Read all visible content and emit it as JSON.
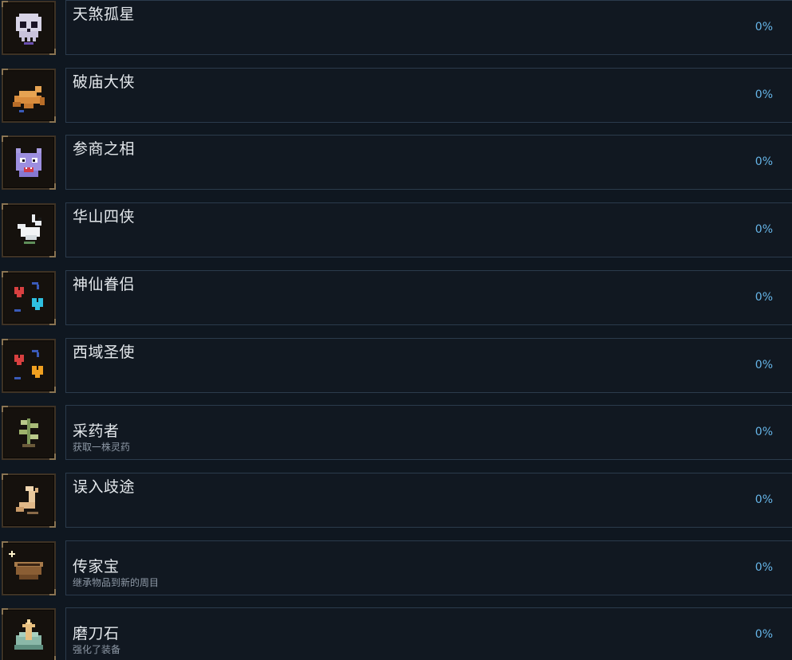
{
  "achievements": [
    {
      "title": "天煞孤星",
      "description": "",
      "percent": "0%",
      "icon": "skull-icon"
    },
    {
      "title": "破庙大侠",
      "description": "",
      "percent": "0%",
      "icon": "fallen-fox-icon"
    },
    {
      "title": "参商之相",
      "description": "",
      "percent": "0%",
      "icon": "purple-demon-face-icon"
    },
    {
      "title": "华山四侠",
      "description": "",
      "percent": "0%",
      "icon": "white-crane-icon"
    },
    {
      "title": "神仙眷侣",
      "description": "",
      "percent": "0%",
      "icon": "red-blue-hearts-icon"
    },
    {
      "title": "西域圣使",
      "description": "",
      "percent": "0%",
      "icon": "red-orange-hearts-icon"
    },
    {
      "title": "采药者",
      "description": "获取一株灵药",
      "percent": "0%",
      "icon": "herb-icon"
    },
    {
      "title": "误入歧途",
      "description": "",
      "percent": "0%",
      "icon": "crescent-arm-icon"
    },
    {
      "title": "传家宝",
      "description": "继承物品到新的周目",
      "percent": "0%",
      "icon": "bowl-icon"
    },
    {
      "title": "磨刀石",
      "description": "强化了装备",
      "percent": "0%",
      "icon": "whetstone-upgrade-icon"
    }
  ]
}
